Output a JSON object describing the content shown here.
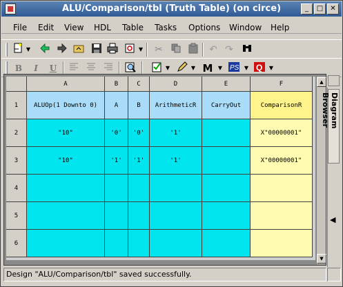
{
  "window": {
    "title": "ALU/Comparison/tbl (Truth Table) (on circe)"
  },
  "title_buttons": {
    "minimize": "_",
    "maximize": "□",
    "close": "✕"
  },
  "menu": [
    "File",
    "Edit",
    "View",
    "HDL",
    "Table",
    "Tasks",
    "Options",
    "Window",
    "Help"
  ],
  "toolbar_icons": {
    "row1": [
      "new-file-icon",
      "back-arrow-icon",
      "forward-arrow-icon",
      "open-folder-icon",
      "save-icon",
      "print-icon",
      "refresh-icon",
      "cut-icon",
      "copy-icon",
      "paste-icon",
      "undo-icon",
      "redo-icon",
      "binoculars-icon"
    ],
    "row2": [
      "bold-icon",
      "italic-icon",
      "underline-icon",
      "align-left-icon",
      "align-center-icon",
      "align-right-icon",
      "search-icon",
      "check-list-icon",
      "pencil-icon",
      "modelsim-icon",
      "precision-icon",
      "questa-icon"
    ]
  },
  "format": {
    "bold": "B",
    "italic": "I",
    "underline": "U"
  },
  "table": {
    "columns": [
      "A",
      "B",
      "C",
      "D",
      "E",
      "F"
    ],
    "rows": [
      "1",
      "2",
      "3",
      "4",
      "5",
      "6"
    ],
    "cells": [
      [
        "ALUOp(1 Downto 0)",
        "A",
        "B",
        "ArithmeticR",
        "CarryOut",
        "ComparisonR"
      ],
      [
        "\"10\"",
        "'0'",
        "'0'",
        "'1'",
        "",
        "X\"00000001\""
      ],
      [
        "\"10\"",
        "'1'",
        "'1'",
        "'1'",
        "",
        "X\"00000001\""
      ],
      [
        "",
        "",
        "",
        "",
        "",
        ""
      ],
      [
        "",
        "",
        "",
        "",
        "",
        ""
      ],
      [
        "",
        "",
        "",
        "",
        "",
        ""
      ]
    ]
  },
  "colors": {
    "input_cell": "#00e5ee",
    "input_header": "#a8dcf8",
    "output_cell": "#fffbb0",
    "output_header": "#fff38c"
  },
  "side_panel": {
    "label": "Diagram Browser"
  },
  "status": {
    "message": "Design \"ALU/Comparison/tbl\" saved successfully."
  }
}
